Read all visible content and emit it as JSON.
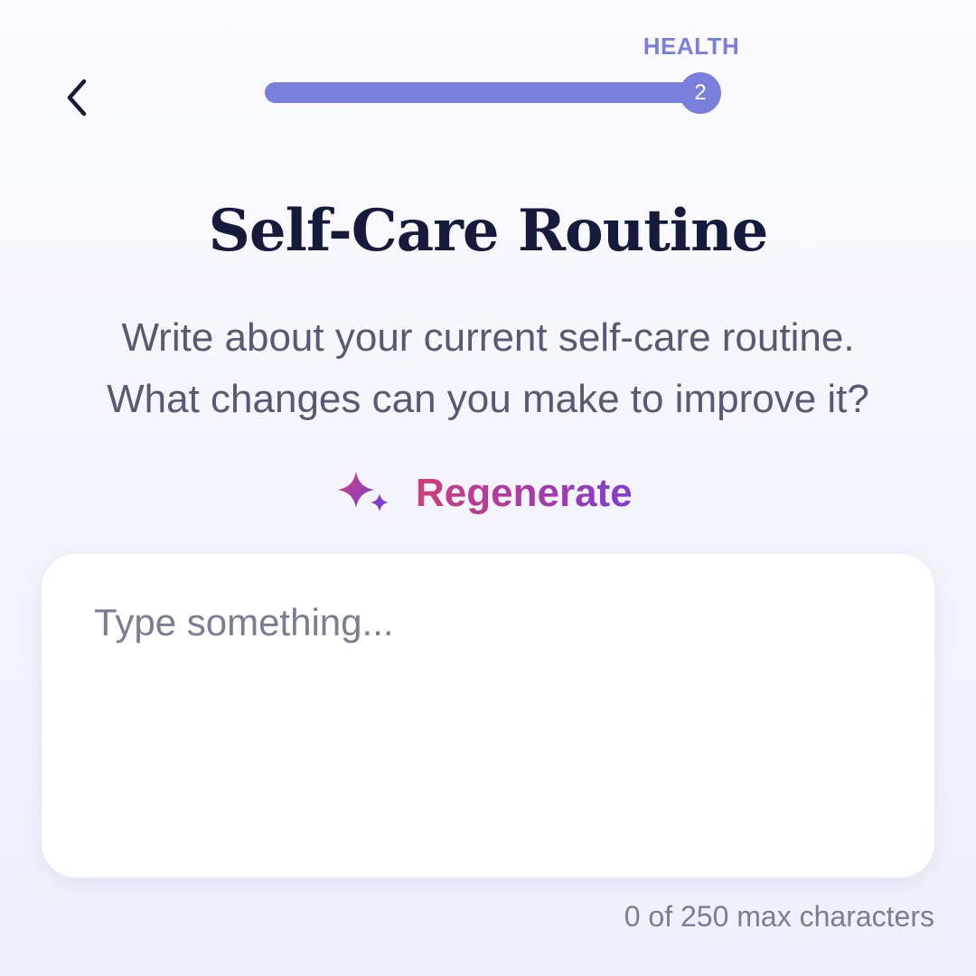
{
  "header": {
    "back_icon": "chevron-left-icon",
    "progress": {
      "category": "HEALTH",
      "step": "2",
      "fraction": 1.0,
      "color": "#7b7fdc"
    }
  },
  "main": {
    "title": "Self-Care Routine",
    "prompt_lines": [
      "Write about your current self-care routine.",
      "What changes can you make to improve it?"
    ],
    "regenerate": {
      "icon": "sparkles-icon",
      "label": "Regenerate",
      "gradient_start": "#cf3d7e",
      "gradient_end": "#7f3ed0"
    },
    "response": {
      "value": "",
      "placeholder": "Type something...",
      "counter": "0 of 250 max characters"
    }
  }
}
